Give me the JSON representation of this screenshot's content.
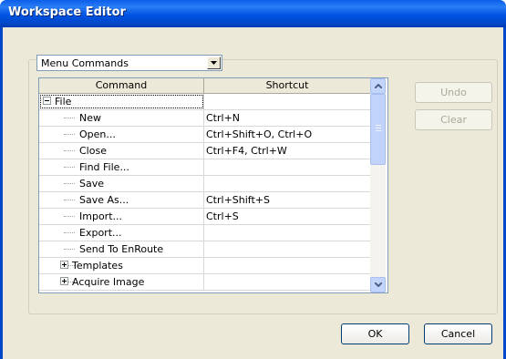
{
  "window": {
    "title": "Workspace Editor"
  },
  "category_select": {
    "value": "Menu Commands"
  },
  "table": {
    "columns": [
      "Command",
      "Shortcut"
    ],
    "rows": [
      {
        "command": "File",
        "shortcut": "",
        "level": 0,
        "expander": "minus"
      },
      {
        "command": "New",
        "shortcut": "Ctrl+N",
        "level": 1
      },
      {
        "command": "Open...",
        "shortcut": "Ctrl+Shift+O, Ctrl+O",
        "level": 1
      },
      {
        "command": "Close",
        "shortcut": "Ctrl+F4, Ctrl+W",
        "level": 1
      },
      {
        "command": "Find File...",
        "shortcut": "",
        "level": 1
      },
      {
        "command": "Save",
        "shortcut": "",
        "level": 1
      },
      {
        "command": "Save As...",
        "shortcut": "Ctrl+Shift+S",
        "level": 1
      },
      {
        "command": "Import...",
        "shortcut": "Ctrl+S",
        "level": 1
      },
      {
        "command": "Export...",
        "shortcut": "",
        "level": 1
      },
      {
        "command": "Send To EnRoute",
        "shortcut": "",
        "level": 1
      },
      {
        "command": "Templates",
        "shortcut": "",
        "level": 1,
        "expander": "plus"
      },
      {
        "command": "Acquire Image",
        "shortcut": "",
        "level": 1,
        "expander": "plus"
      }
    ]
  },
  "buttons": {
    "undo": "Undo",
    "clear": "Clear",
    "ok": "OK",
    "cancel": "Cancel"
  },
  "icons": {
    "scroll_up": "chevron-up-icon",
    "scroll_down": "chevron-down-icon",
    "combo": "dropdown-arrow-icon"
  }
}
